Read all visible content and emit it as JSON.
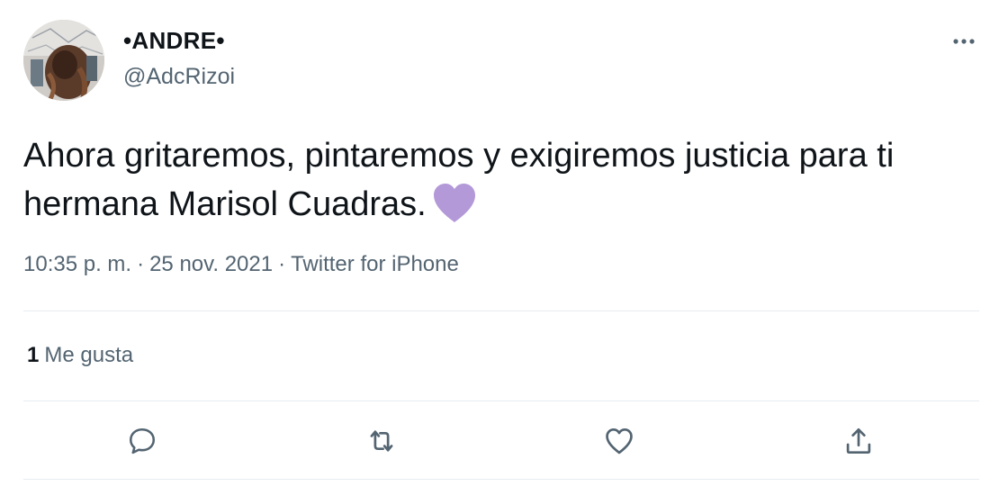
{
  "user": {
    "display_name": "•ANDRE•",
    "handle": "@AdcRizoi"
  },
  "tweet": {
    "text": "Ahora gritaremos, pintaremos y exigiremos justicia para ti hermana Marisol Cuadras.",
    "emoji": "purple-heart",
    "emoji_color": "#b399d8"
  },
  "meta": {
    "time": "10:35 p. m.",
    "separator": "·",
    "date": "25 nov. 2021",
    "source": "Twitter for iPhone"
  },
  "stats": {
    "likes_count": "1",
    "likes_label": "Me gusta"
  },
  "actions": [
    {
      "icon": "reply-icon"
    },
    {
      "icon": "retweet-icon"
    },
    {
      "icon": "like-icon"
    },
    {
      "icon": "share-icon"
    }
  ],
  "colors": {
    "text_primary": "#0f1419",
    "text_secondary": "#536471",
    "divider": "#e6ecf0"
  }
}
